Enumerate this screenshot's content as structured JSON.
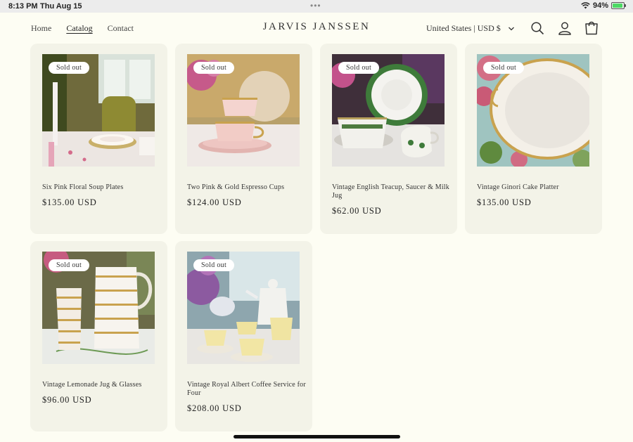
{
  "status_bar": {
    "time": "8:13 PM",
    "date": "Thu Aug 15",
    "battery": "94%",
    "battery_level": 0.94
  },
  "header": {
    "nav": [
      {
        "label": "Home",
        "active": false
      },
      {
        "label": "Catalog",
        "active": true
      },
      {
        "label": "Contact",
        "active": false
      }
    ],
    "brand": "JARVIS JANSSEN",
    "locale": "United States | USD $",
    "icons": [
      "search-icon",
      "account-icon",
      "cart-icon"
    ]
  },
  "products": [
    {
      "badge": "Sold out",
      "title": "Six Pink Floral Soup Plates",
      "price": "$135.00 USD"
    },
    {
      "badge": "Sold out",
      "title": "Two Pink & Gold Espresso Cups",
      "price": "$124.00 USD"
    },
    {
      "badge": "Sold out",
      "title": "Vintage English Teacup, Saucer & Milk Jug",
      "price": "$62.00 USD"
    },
    {
      "badge": "Sold out",
      "title": "Vintage Ginori Cake Platter",
      "price": "$135.00 USD"
    },
    {
      "badge": "Sold out",
      "title": "Vintage Lemonade Jug & Glasses",
      "price": "$96.00 USD"
    },
    {
      "badge": "Sold out",
      "title": "Vintage Royal Albert Coffee Service for Four",
      "price": "$208.00 USD"
    }
  ]
}
